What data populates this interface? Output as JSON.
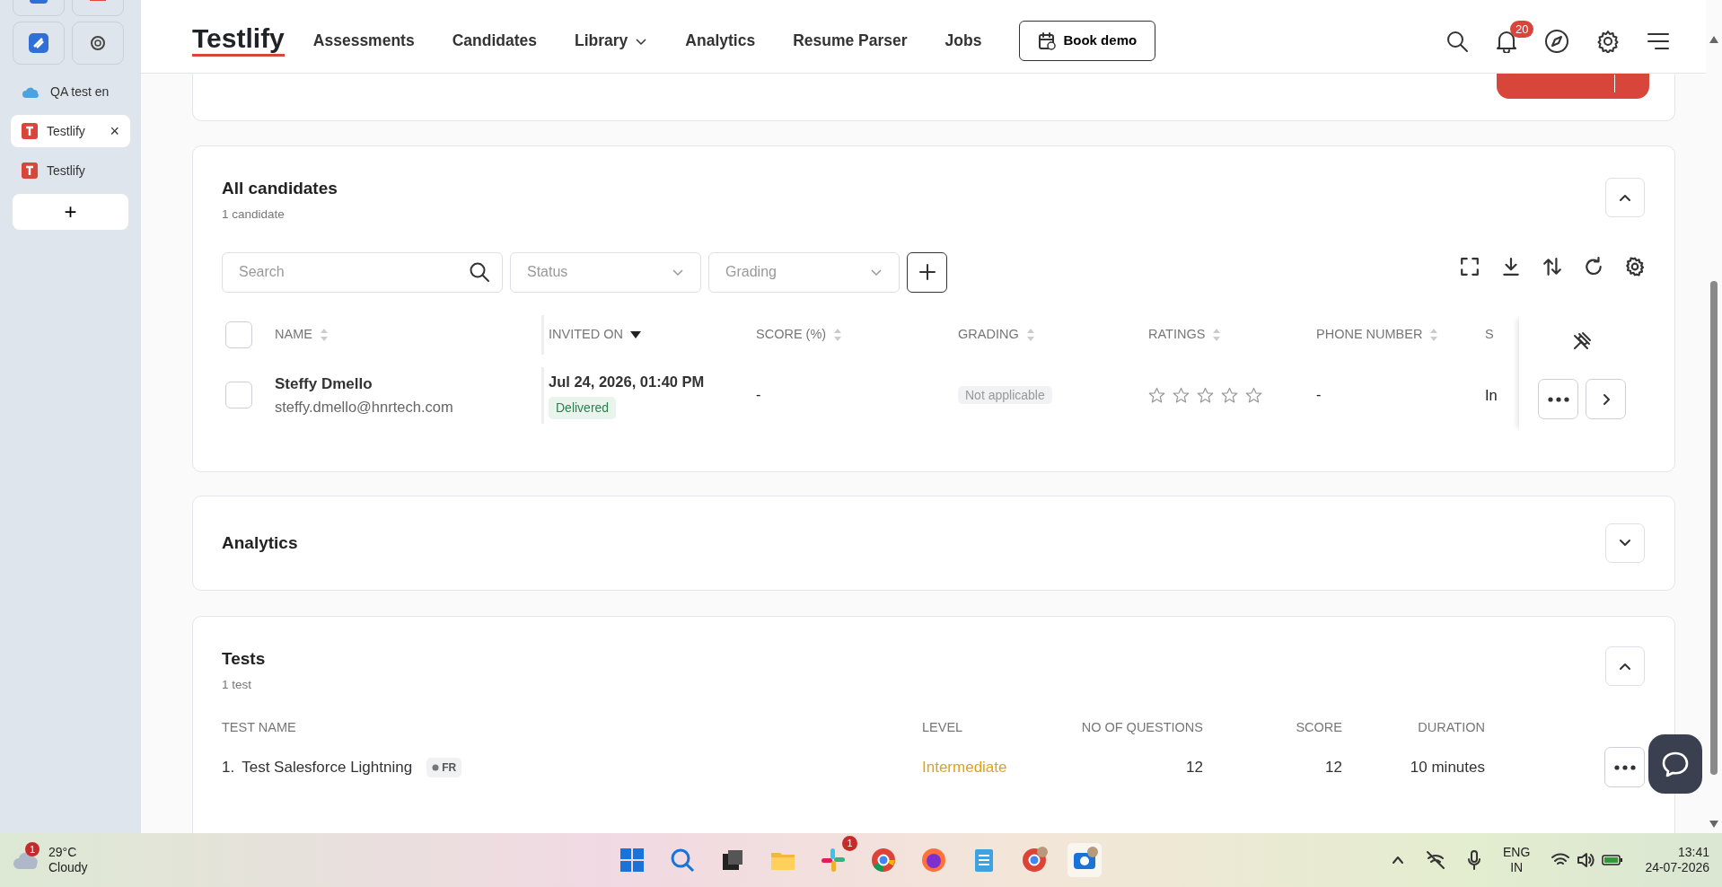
{
  "sidebar": {
    "tabs": [
      {
        "label": "QA test en",
        "kind": "cloud",
        "selected": false
      },
      {
        "label": "Testlify",
        "kind": "logo",
        "selected": true,
        "close": "×"
      },
      {
        "label": "Testlify",
        "kind": "logo",
        "selected": false
      }
    ],
    "add": "+"
  },
  "navbar": {
    "brand": "Testlify",
    "links": [
      {
        "label": "Assessments",
        "dropdown": false
      },
      {
        "label": "Candidates",
        "dropdown": false
      },
      {
        "label": "Library",
        "dropdown": true
      },
      {
        "label": "Analytics",
        "dropdown": false
      },
      {
        "label": "Resume Parser",
        "dropdown": false
      },
      {
        "label": "Jobs",
        "dropdown": false
      }
    ],
    "book_demo": "Book demo",
    "notifications": "20"
  },
  "candidates": {
    "title": "All candidates",
    "subtitle": "1 candidate",
    "expanded": true,
    "search": {
      "placeholder": "Search"
    },
    "filters": [
      {
        "placeholder": "Status"
      },
      {
        "placeholder": "Grading"
      }
    ],
    "columns": [
      {
        "label": "NAME",
        "sorted": false
      },
      {
        "label": "INVITED ON",
        "sorted": true
      },
      {
        "label": "SCORE (%)",
        "sorted": false
      },
      {
        "label": "GRADING",
        "sorted": false
      },
      {
        "label": "RATINGS",
        "sorted": false
      },
      {
        "label": "PHONE NUMBER",
        "sorted": false
      },
      {
        "label": "S"
      }
    ],
    "select_all": {
      "checked": false
    },
    "rows": [
      {
        "checked": false,
        "name": "Steffy Dmello",
        "email": "steffy.dmello@hnrtech.com",
        "invited_on": "Jul 24, 2026, 01:40 PM",
        "status": "Delivered",
        "score": "-",
        "grading": "Not applicable",
        "stars": 0,
        "phone": "-",
        "column_8": "In"
      }
    ]
  },
  "analytics": {
    "title": "Analytics",
    "expanded": false
  },
  "tests": {
    "title": "Tests",
    "subtitle": "1 test",
    "expanded": true,
    "columns": [
      "TEST NAME",
      "LEVEL",
      "NO OF QUESTIONS",
      "SCORE",
      "DURATION"
    ],
    "rows": [
      {
        "index": "1.",
        "name": "Test Salesforce Lightning",
        "tag": "FR",
        "level": "Intermediate",
        "questions": "12",
        "score": "12",
        "duration": "10 minutes"
      }
    ]
  },
  "taskbar": {
    "weather": {
      "badge": "1",
      "temp": "29°C",
      "condition": "Cloudy"
    },
    "slack_badge": "1",
    "language": "ENG",
    "region": "IN",
    "time": "13:41",
    "date": "24-07-2026"
  }
}
